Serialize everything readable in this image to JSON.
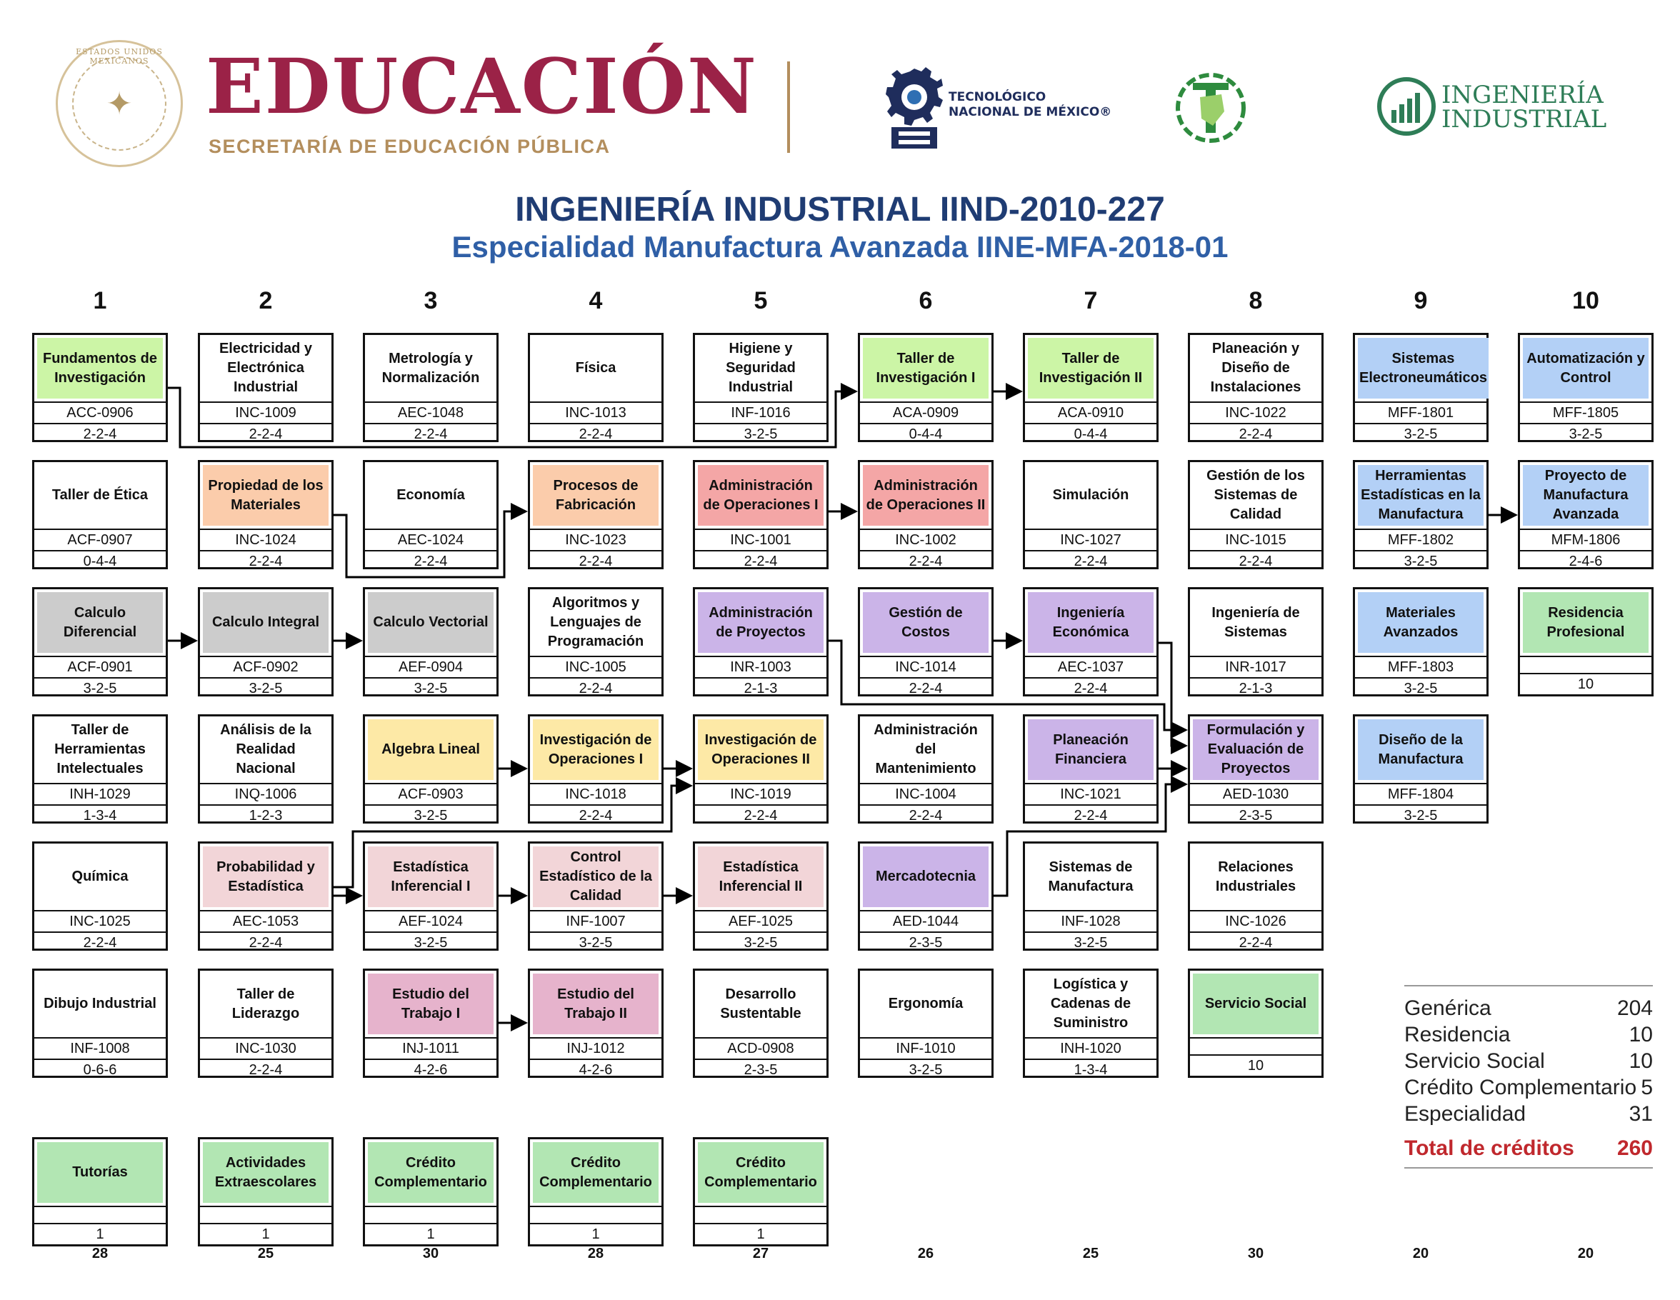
{
  "header": {
    "seal_text": "ESTADOS UNIDOS MEXICANOS",
    "edu_title": "EDUCACIÓN",
    "edu_subtitle": "SECRETARÍA DE EDUCACIÓN PÚBLICA",
    "tec_line1": "TECNOLÓGICO",
    "tec_line2": "NACIONAL DE MÉXICO®",
    "ii_line1": "INGENIERÍA",
    "ii_line2": "INDUSTRIAL"
  },
  "title": "INGENIERÍA INDUSTRIAL IIND-2010-227",
  "subtitle": "Especialidad Manufactura Avanzada IINE-MFA-2018-01",
  "semesters": [
    "1",
    "2",
    "3",
    "4",
    "5",
    "6",
    "7",
    "8",
    "9",
    "10"
  ],
  "semester_credits": [
    "28",
    "25",
    "30",
    "28",
    "27",
    "26",
    "25",
    "30",
    "20",
    "20"
  ],
  "colors": {
    "green": "#ccf5a6",
    "orange": "#fbccab",
    "red": "#f4a6a6",
    "blue": "#b3d0f6",
    "gray": "#cccccc",
    "purple": "#cbb4e8",
    "yellow": "#fde9a6",
    "pink": "#f2d5d8",
    "magenta": "#e6b3cc",
    "light_green": "#b2e6b3",
    "title_blue": "#1f3c73",
    "edu_red": "#9b2247",
    "total_red": "#c0282d"
  },
  "courses": [
    {
      "name": "Fundamentos de Investigación",
      "code": "ACC-0906",
      "credits": "2-2-4",
      "color": "green"
    },
    {
      "name": "Taller de Ética",
      "code": "ACF-0907",
      "credits": "0-4-4",
      "color": ""
    },
    {
      "name": "Calculo Diferencial",
      "code": "ACF-0901",
      "credits": "3-2-5",
      "color": "gray"
    },
    {
      "name": "Taller de Herramientas Intelectuales",
      "code": "INH-1029",
      "credits": "1-3-4",
      "color": ""
    },
    {
      "name": "Química",
      "code": "INC-1025",
      "credits": "2-2-4",
      "color": ""
    },
    {
      "name": "Dibujo Industrial",
      "code": "INF-1008",
      "credits": "0-6-6",
      "color": ""
    },
    {
      "name": "Electricidad y Electrónica Industrial",
      "code": "INC-1009",
      "credits": "2-2-4",
      "color": ""
    },
    {
      "name": "Propiedad de los Materiales",
      "code": "INC-1024",
      "credits": "2-2-4",
      "color": "orange"
    },
    {
      "name": "Calculo Integral",
      "code": "ACF-0902",
      "credits": "3-2-5",
      "color": "gray"
    },
    {
      "name": "Análisis de la Realidad Nacional",
      "code": "INQ-1006",
      "credits": "1-2-3",
      "color": ""
    },
    {
      "name": "Probabilidad y Estadística",
      "code": "AEC-1053",
      "credits": "2-2-4",
      "color": "pink"
    },
    {
      "name": "Taller de Liderazgo",
      "code": "INC-1030",
      "credits": "2-2-4",
      "color": ""
    },
    {
      "name": "Metrología y Normalización",
      "code": "AEC-1048",
      "credits": "2-2-4",
      "color": ""
    },
    {
      "name": "Economía",
      "code": "AEC-1024",
      "credits": "2-2-4",
      "color": ""
    },
    {
      "name": "Calculo Vectorial",
      "code": "AEF-0904",
      "credits": "3-2-5",
      "color": "gray"
    },
    {
      "name": "Algebra Lineal",
      "code": "ACF-0903",
      "credits": "3-2-5",
      "color": "yellow"
    },
    {
      "name": "Estadística Inferencial I",
      "code": "AEF-1024",
      "credits": "3-2-5",
      "color": "pink"
    },
    {
      "name": "Estudio del Trabajo I",
      "code": "INJ-1011",
      "credits": "4-2-6",
      "color": "magenta"
    },
    {
      "name": "Física",
      "code": "INC-1013",
      "credits": "2-2-4",
      "color": ""
    },
    {
      "name": "Procesos de Fabricación",
      "code": "INC-1023",
      "credits": "2-2-4",
      "color": "orange"
    },
    {
      "name": "Algoritmos y Lenguajes de Programación",
      "code": "INC-1005",
      "credits": "2-2-4",
      "color": ""
    },
    {
      "name": "Investigación de Operaciones I",
      "code": "INC-1018",
      "credits": "2-2-4",
      "color": "yellow"
    },
    {
      "name": "Control Estadístico de la Calidad",
      "code": "INF-1007",
      "credits": "3-2-5",
      "color": "pink"
    },
    {
      "name": "Estudio del Trabajo II",
      "code": "INJ-1012",
      "credits": "4-2-6",
      "color": "magenta"
    },
    {
      "name": "Higiene y Seguridad Industrial",
      "code": "INF-1016",
      "credits": "3-2-5",
      "color": ""
    },
    {
      "name": "Administración de Operaciones I",
      "code": "INC-1001",
      "credits": "2-2-4",
      "color": "red"
    },
    {
      "name": "Administración de Proyectos",
      "code": "INR-1003",
      "credits": "2-1-3",
      "color": "purple"
    },
    {
      "name": "Investigación de Operaciones II",
      "code": "INC-1019",
      "credits": "2-2-4",
      "color": "yellow"
    },
    {
      "name": "Estadística Inferencial II",
      "code": "AEF-1025",
      "credits": "3-2-5",
      "color": "pink"
    },
    {
      "name": "Desarrollo Sustentable",
      "code": "ACD-0908",
      "credits": "2-3-5",
      "color": ""
    },
    {
      "name": "Taller de Investigación I",
      "code": "ACA-0909",
      "credits": "0-4-4",
      "color": "green"
    },
    {
      "name": "Administración de Operaciones II",
      "code": "INC-1002",
      "credits": "2-2-4",
      "color": "red"
    },
    {
      "name": "Gestión de Costos",
      "code": "INC-1014",
      "credits": "2-2-4",
      "color": "purple"
    },
    {
      "name": "Administración del Mantenimiento",
      "code": "INC-1004",
      "credits": "2-2-4",
      "color": ""
    },
    {
      "name": "Mercadotecnia",
      "code": "AED-1044",
      "credits": "2-3-5",
      "color": "purple"
    },
    {
      "name": "Ergonomía",
      "code": "INF-1010",
      "credits": "3-2-5",
      "color": ""
    },
    {
      "name": "Taller de Investigación II",
      "code": "ACA-0910",
      "credits": "0-4-4",
      "color": "green"
    },
    {
      "name": "Simulación",
      "code": "INC-1027",
      "credits": "2-2-4",
      "color": ""
    },
    {
      "name": "Ingeniería Económica",
      "code": "AEC-1037",
      "credits": "2-2-4",
      "color": "purple"
    },
    {
      "name": "Planeación Financiera",
      "code": "INC-1021",
      "credits": "2-2-4",
      "color": "purple"
    },
    {
      "name": "Sistemas de Manufactura",
      "code": "INF-1028",
      "credits": "3-2-5",
      "color": ""
    },
    {
      "name": "Logística y Cadenas de Suministro",
      "code": "INH-1020",
      "credits": "1-3-4",
      "color": ""
    },
    {
      "name": "Planeación y Diseño de Instalaciones",
      "code": "INC-1022",
      "credits": "2-2-4",
      "color": ""
    },
    {
      "name": "Gestión de los Sistemas de Calidad",
      "code": "INC-1015",
      "credits": "2-2-4",
      "color": ""
    },
    {
      "name": "Ingeniería de Sistemas",
      "code": "INR-1017",
      "credits": "2-1-3",
      "color": ""
    },
    {
      "name": "Formulación y Evaluación de Proyectos",
      "code": "AED-1030",
      "credits": "2-3-5",
      "color": "purple"
    },
    {
      "name": "Relaciones Industriales",
      "code": "INC-1026",
      "credits": "2-2-4",
      "color": ""
    },
    {
      "name": "Servicio Social",
      "code": "",
      "credits": "10",
      "color": "light_green"
    },
    {
      "name": "Sistemas Electroneumáticos",
      "code": "MFF-1801",
      "credits": "3-2-5",
      "color": "blue"
    },
    {
      "name": "Herramientas Estadísticas en la Manufactura",
      "code": "MFF-1802",
      "credits": "3-2-5",
      "color": "blue"
    },
    {
      "name": "Materiales Avanzados",
      "code": "MFF-1803",
      "credits": "3-2-5",
      "color": "blue"
    },
    {
      "name": "Diseño de la Manufactura",
      "code": "MFF-1804",
      "credits": "3-2-5",
      "color": "blue"
    },
    {
      "name": "Automatización y Control",
      "code": "MFF-1805",
      "credits": "3-2-5",
      "color": "blue"
    },
    {
      "name": "Proyecto de Manufactura Avanzada",
      "code": "MFM-1806",
      "credits": "2-4-6",
      "color": "blue"
    },
    {
      "name": "Residencia Profesional",
      "code": "",
      "credits": "10",
      "color": "light_green"
    },
    {
      "name": "Tutorías",
      "code": "",
      "credits": "1",
      "color": "light_green"
    },
    {
      "name": "Actividades Extraescolares",
      "code": "",
      "credits": "1",
      "color": "light_green"
    },
    {
      "name": "Crédito Complementario",
      "code": "",
      "credits": "1",
      "color": "light_green"
    },
    {
      "name": "Crédito Complementario",
      "code": "",
      "credits": "1",
      "color": "light_green"
    },
    {
      "name": "Crédito Complementario",
      "code": "",
      "credits": "1",
      "color": "light_green"
    }
  ],
  "summary": {
    "rows": [
      {
        "label": "Genérica",
        "value": "204"
      },
      {
        "label": "Residencia",
        "value": "10"
      },
      {
        "label": "Servicio Social",
        "value": "10"
      },
      {
        "label": "Crédito Complementario",
        "value": "5"
      },
      {
        "label": "Especialidad",
        "value": "31"
      }
    ],
    "total_label": "Total de créditos",
    "total_value": "260"
  }
}
